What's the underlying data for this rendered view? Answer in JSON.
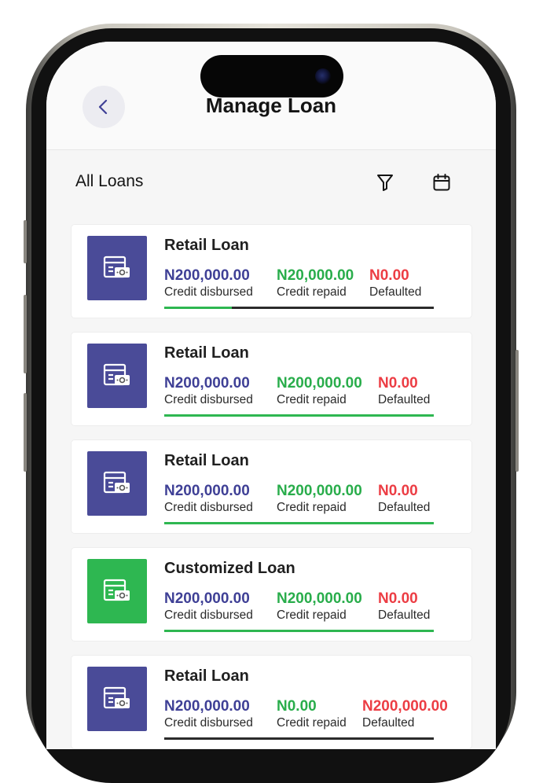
{
  "header": {
    "title": "Manage Loan",
    "back_icon": "chevron-left-icon"
  },
  "toolbar": {
    "title": "All Loans",
    "filter_icon": "filter-icon",
    "calendar_icon": "calendar-icon"
  },
  "colors": {
    "brand_blue": "#4a4b98",
    "brand_green": "#2eb751",
    "amount_blue": "#3f4096",
    "amount_green": "#29ad4b",
    "amount_red": "#ec3d44"
  },
  "loans": [
    {
      "title": "Retail Loan",
      "icon": "loan-store-icon",
      "icon_color": "#4a4b98",
      "disbursed": "N200,000.00",
      "disbursed_label": "Credit disbursed",
      "repaid": "N20,000.00",
      "repaid_label": "Credit repaid",
      "defaulted": "N0.00",
      "defaulted_label": "Defaulted",
      "repaid_progress": 0.25
    },
    {
      "title": "Retail Loan",
      "icon": "loan-store-icon",
      "icon_color": "#4a4b98",
      "disbursed": "N200,000.00",
      "disbursed_label": "Credit disbursed",
      "repaid": "N200,000.00",
      "repaid_label": "Credit repaid",
      "defaulted": "N0.00",
      "defaulted_label": "Defaulted",
      "repaid_progress": 1.0
    },
    {
      "title": "Retail Loan",
      "icon": "loan-store-icon",
      "icon_color": "#4a4b98",
      "disbursed": "N200,000.00",
      "disbursed_label": "Credit disbursed",
      "repaid": "N200,000.00",
      "repaid_label": "Credit repaid",
      "defaulted": "N0.00",
      "defaulted_label": "Defaulted",
      "repaid_progress": 1.0
    },
    {
      "title": "Customized Loan",
      "icon": "loan-store-icon",
      "icon_color": "#2eb751",
      "disbursed": "N200,000.00",
      "disbursed_label": "Credit disbursed",
      "repaid": "N200,000.00",
      "repaid_label": "Credit repaid",
      "defaulted": "N0.00",
      "defaulted_label": "Defaulted",
      "repaid_progress": 1.0
    },
    {
      "title": "Retail Loan",
      "icon": "loan-store-icon",
      "icon_color": "#4a4b98",
      "disbursed": "N200,000.00",
      "disbursed_label": "Credit disbursed",
      "repaid": "N0.00",
      "repaid_label": "Credit repaid",
      "defaulted": "N200,000.00",
      "defaulted_label": "Defaulted",
      "repaid_progress": 0.0
    }
  ]
}
